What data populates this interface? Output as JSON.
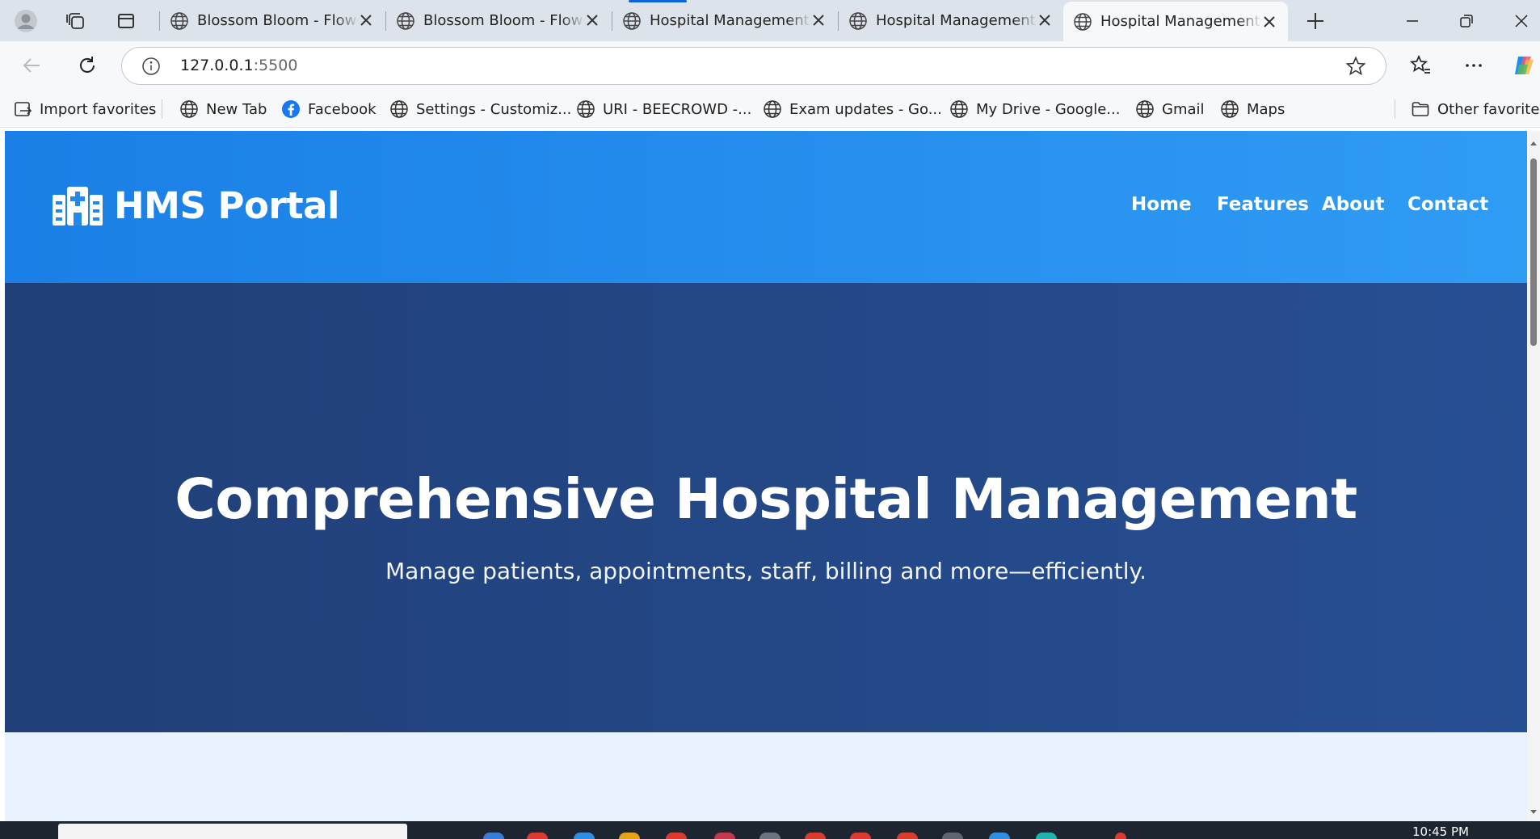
{
  "browser": {
    "tabs": [
      {
        "title": "Blossom Bloom - Flower Shop",
        "active": false
      },
      {
        "title": "Blossom Bloom - Flower Shop",
        "active": false
      },
      {
        "title": "Hospital Management System",
        "active": false
      },
      {
        "title": "Hospital Management System",
        "active": false
      },
      {
        "title": "Hospital Management System",
        "active": true
      }
    ],
    "address": {
      "host": "127.0.0.1",
      "port": ":5500"
    },
    "favorites": [
      {
        "label": "Import favorites",
        "icon": "import-icon"
      },
      {
        "label": "New Tab",
        "icon": "globe-icon"
      },
      {
        "label": "Facebook",
        "icon": "facebook-icon"
      },
      {
        "label": "Settings - Customiz...",
        "icon": "globe-icon"
      },
      {
        "label": "URI - BEECROWD -...",
        "icon": "globe-icon"
      },
      {
        "label": "Exam updates - Go...",
        "icon": "globe-icon"
      },
      {
        "label": "My Drive - Google...",
        "icon": "globe-icon"
      },
      {
        "label": "Gmail",
        "icon": "globe-icon"
      },
      {
        "label": "Maps",
        "icon": "globe-icon"
      }
    ],
    "other_favorites": "Other favorites"
  },
  "page": {
    "logo": {
      "icon": "hospital-icon",
      "text": "HMS Portal"
    },
    "nav": [
      "Home",
      "Features",
      "About",
      "Contact"
    ],
    "hero": {
      "title": "Comprehensive Hospital Management",
      "subtitle": "Manage patients, appointments, staff, billing and more—efficiently."
    }
  },
  "taskbar": {
    "clock": "10:45 PM"
  },
  "colors": {
    "header_gradient": [
      "#1a7fe6",
      "#2f9cf4"
    ],
    "hero_gradient": [
      "#203f78",
      "#274f93"
    ],
    "page_background": "#e9f3ff"
  }
}
